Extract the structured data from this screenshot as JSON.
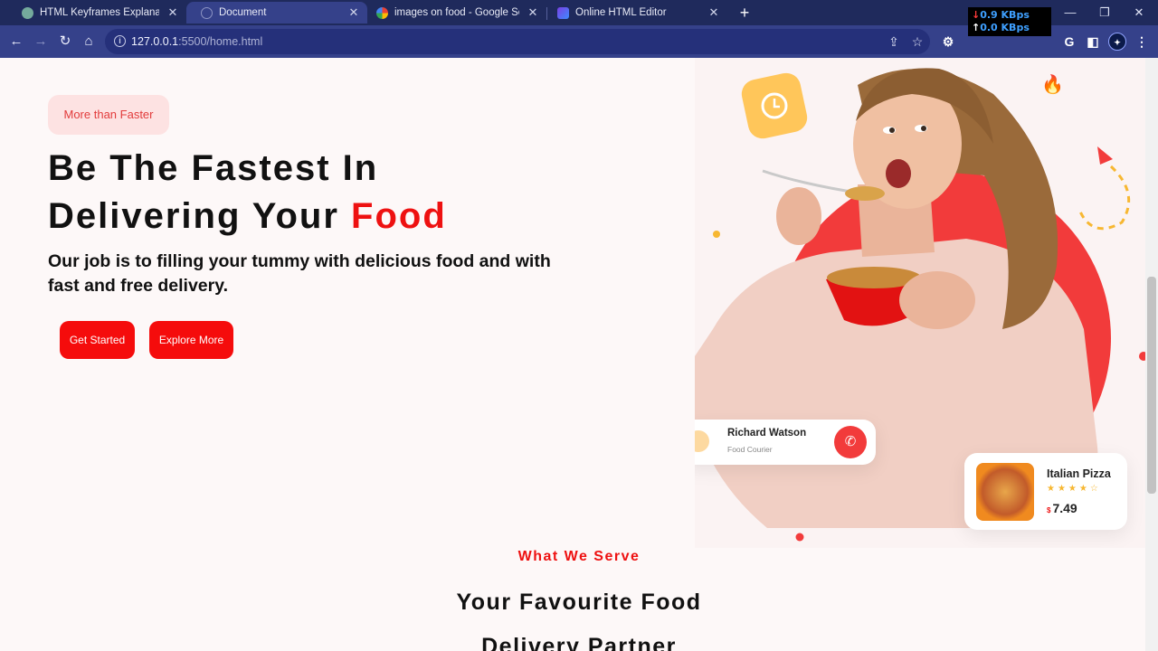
{
  "browser": {
    "tabs": [
      {
        "label": "HTML Keyframes Explanation",
        "icon": "chatgpt-icon",
        "active": false
      },
      {
        "label": "Document",
        "icon": "globe-icon",
        "active": true
      },
      {
        "label": "images on food - Google Search",
        "icon": "google-icon",
        "active": false
      },
      {
        "label": "Online HTML Editor",
        "icon": "editor-icon",
        "active": false
      }
    ],
    "close_glyph": "✕",
    "new_tab_glyph": "+",
    "url_host": "127.0.0.1",
    "url_path": ":5500/home.html",
    "net_down": "0.9 KBps",
    "net_up": "0.0 KBps"
  },
  "hero": {
    "badge": "More than Faster",
    "title_line1": "Be The Fastest In",
    "title_line2_prefix": "Delivering Your ",
    "title_line2_highlight": "Food",
    "subtitle": "Our job is to filling your tummy with delicious food and with fast and free delivery.",
    "buttons": {
      "get_started": "Get Started",
      "explore_more": "Explore More"
    }
  },
  "courier_card": {
    "name": "Richard Watson",
    "role": "Food Courier"
  },
  "food_card": {
    "name": "Italian Pizza",
    "stars": "★★★★☆",
    "rating": 4,
    "currency": "$",
    "price": "7.49"
  },
  "section": {
    "eyebrow": "What We Serve",
    "title_line1": "Your Favourite Food",
    "title_line2": "Delivery Partner"
  },
  "colors": {
    "accent": "#ee1111",
    "button": "#f50c0c",
    "badge_bg": "#fde2e2",
    "chrome_dark": "#1f2a5c",
    "chrome": "#35418a"
  }
}
